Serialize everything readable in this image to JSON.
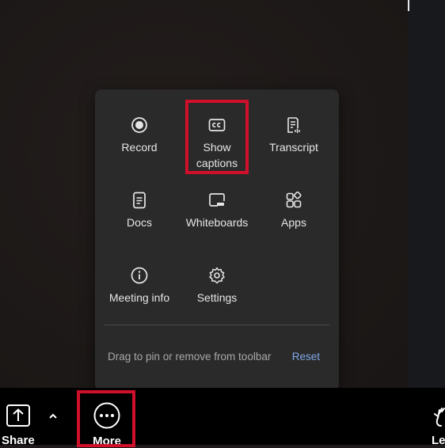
{
  "more_menu": {
    "items": [
      {
        "label": "Record",
        "icon": "record-icon"
      },
      {
        "label": "Show captions",
        "icon": "closed-captions-icon"
      },
      {
        "label": "Transcript",
        "icon": "transcript-icon"
      },
      {
        "label": "Docs",
        "icon": "docs-icon"
      },
      {
        "label": "Whiteboards",
        "icon": "whiteboard-icon"
      },
      {
        "label": "Apps",
        "icon": "apps-icon"
      },
      {
        "label": "Meeting info",
        "icon": "info-icon"
      },
      {
        "label": "Settings",
        "icon": "gear-icon"
      }
    ],
    "footer_hint": "Drag to pin or remove from toolbar",
    "reset_label": "Reset"
  },
  "toolbar": {
    "share_label": "Share",
    "more_label": "More",
    "leave_label": "Le"
  },
  "colors": {
    "highlight": "#d0102a",
    "link": "#7fa8e6",
    "menu_bg": "#2a2a2a"
  }
}
